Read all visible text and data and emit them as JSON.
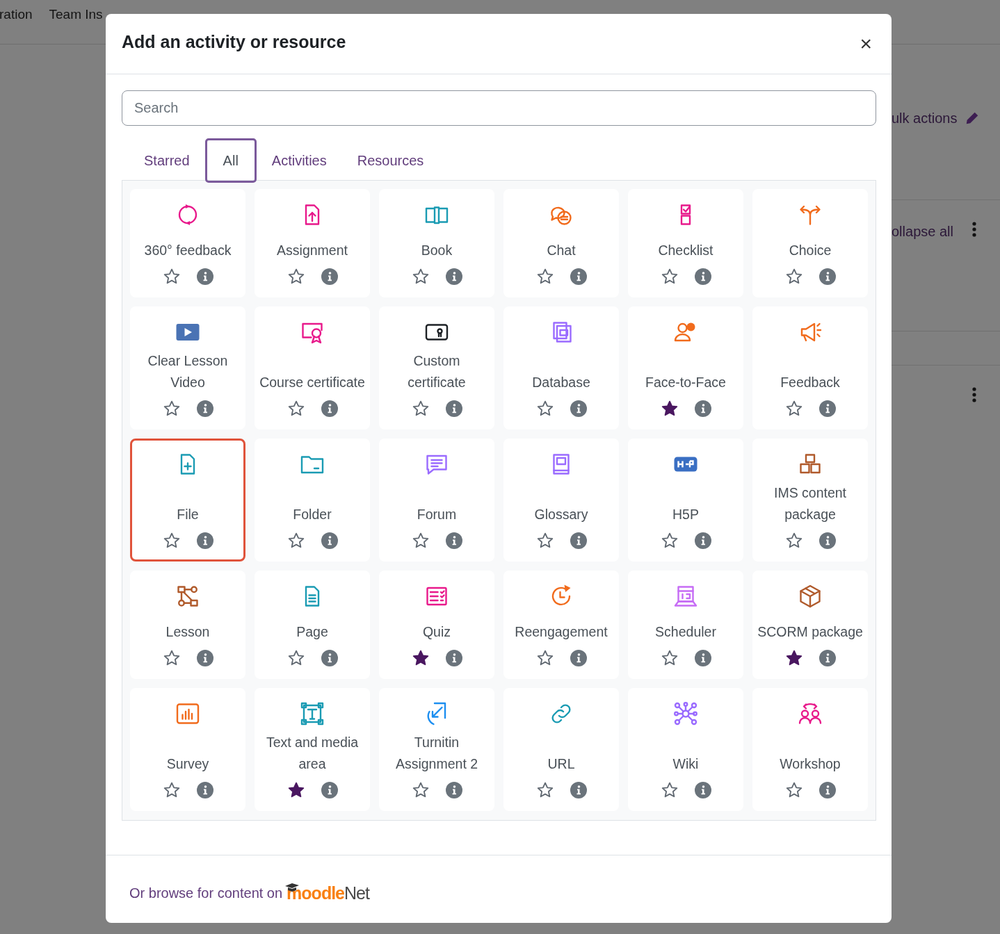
{
  "background_page": {
    "nav": [
      "ration",
      "Team Ins"
    ],
    "bulk_actions": "ulk actions",
    "collapse_all": "ollapse all"
  },
  "dialog": {
    "title": "Add an activity or resource",
    "close": "×",
    "search": {
      "placeholder": "Search"
    },
    "tabs": [
      {
        "label": "Starred",
        "selected": false
      },
      {
        "label": "All",
        "selected": true
      },
      {
        "label": "Activities",
        "selected": false
      },
      {
        "label": "Resources",
        "selected": false
      }
    ],
    "items": [
      {
        "name": "360° feedback",
        "starred": false,
        "selected": false
      },
      {
        "name": "Assignment",
        "starred": false,
        "selected": false
      },
      {
        "name": "Book",
        "starred": false,
        "selected": false
      },
      {
        "name": "Chat",
        "starred": false,
        "selected": false
      },
      {
        "name": "Checklist",
        "starred": false,
        "selected": false
      },
      {
        "name": "Choice",
        "starred": false,
        "selected": false
      },
      {
        "name": "Clear Lesson Video",
        "starred": false,
        "selected": false
      },
      {
        "name": "Course certificate",
        "starred": false,
        "selected": false
      },
      {
        "name": "Custom certificate",
        "starred": false,
        "selected": false
      },
      {
        "name": "Database",
        "starred": false,
        "selected": false
      },
      {
        "name": "Face-to-Face",
        "starred": true,
        "selected": false
      },
      {
        "name": "Feedback",
        "starred": false,
        "selected": false
      },
      {
        "name": "File",
        "starred": false,
        "selected": true
      },
      {
        "name": "Folder",
        "starred": false,
        "selected": false
      },
      {
        "name": "Forum",
        "starred": false,
        "selected": false
      },
      {
        "name": "Glossary",
        "starred": false,
        "selected": false
      },
      {
        "name": "H5P",
        "starred": false,
        "selected": false
      },
      {
        "name": "IMS content package",
        "starred": false,
        "selected": false
      },
      {
        "name": "Lesson",
        "starred": false,
        "selected": false
      },
      {
        "name": "Page",
        "starred": false,
        "selected": false
      },
      {
        "name": "Quiz",
        "starred": true,
        "selected": false
      },
      {
        "name": "Reengagement",
        "starred": false,
        "selected": false
      },
      {
        "name": "Scheduler",
        "starred": false,
        "selected": false
      },
      {
        "name": "SCORM package",
        "starred": true,
        "selected": false
      },
      {
        "name": "Survey",
        "starred": false,
        "selected": false
      },
      {
        "name": "Text and media area",
        "starred": true,
        "selected": false
      },
      {
        "name": "Turnitin Assignment 2",
        "starred": false,
        "selected": false
      },
      {
        "name": "URL",
        "starred": false,
        "selected": false
      },
      {
        "name": "Wiki",
        "starred": false,
        "selected": false
      },
      {
        "name": "Workshop",
        "starred": false,
        "selected": false
      }
    ],
    "footer": {
      "text": "Or browse for content on",
      "logo": {
        "primary": "moodle",
        "secondary": "Net"
      }
    }
  }
}
